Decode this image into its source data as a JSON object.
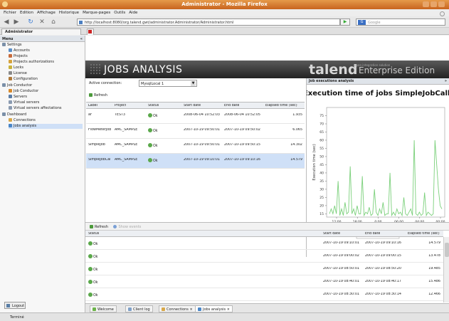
{
  "window": {
    "title": "Administrator - Mozilla Firefox"
  },
  "menubar": [
    "Fichier",
    "Edition",
    "Affichage",
    "Historique",
    "Marque-pages",
    "Outils",
    "Aide"
  ],
  "navbar": {
    "url": "http://localhost:8080/org.talend.gwt/administrator.Administrator/Administrator.html",
    "search_placeholder": "Google"
  },
  "page_tab": {
    "label": "Administrator"
  },
  "sidebar": {
    "header": "Menu",
    "items": [
      {
        "label": "Settings"
      },
      {
        "label": "Accounts"
      },
      {
        "label": "Projects"
      },
      {
        "label": "Projects authorizations"
      },
      {
        "label": "Locks"
      },
      {
        "label": "License"
      },
      {
        "label": "Configuration"
      },
      {
        "label": "Job Conductor"
      },
      {
        "label": "Job Conductor"
      },
      {
        "label": "Servers"
      },
      {
        "label": "Virtual servers"
      },
      {
        "label": "Virtual servers affectations"
      },
      {
        "label": "Dashboard"
      },
      {
        "label": "Connections"
      },
      {
        "label": "Jobs analysis"
      }
    ],
    "logout": "Logout"
  },
  "banner": {
    "title": "JOBS ANALYSIS",
    "logo": "talend",
    "logo_sub": "Enterprise Edition",
    "logo_small": "open integration solution"
  },
  "connection": {
    "label": "Active connection:",
    "value": "MysqlLocal 1"
  },
  "refresh_label": "Refresh",
  "jobs_grid": {
    "columns": [
      "Label",
      "Project",
      "Status",
      "Start date",
      "End date",
      "Elapsed time (sec)"
    ],
    "rows": [
      {
        "label": "ar",
        "project": "TEST3",
        "status": "Ok",
        "start": "2008-06-04 10:52:03",
        "end": "2008-06-04 10:52:05",
        "elapsed": "1.935"
      },
      {
        "label": "FlowMeterJob",
        "project": "AMC_SAMPLE",
        "status": "Ok",
        "start": "2007-10-19 09:50:01",
        "end": "2007-10-19 09:50:02",
        "elapsed": "6.065"
      },
      {
        "label": "SimpleJob",
        "project": "AMC_SAMPLE",
        "status": "Ok",
        "start": "2007-10-19 09:50:01",
        "end": "2007-10-19 09:50:15",
        "elapsed": "14.302"
      },
      {
        "label": "SimpleJobCal",
        "project": "AMC_SAMPLE",
        "status": "Ok",
        "start": "2007-10-19 09:10:01",
        "end": "2007-10-19 09:10:16",
        "elapsed": "14.579"
      }
    ]
  },
  "chart_panel": {
    "header": "Job executions analysis"
  },
  "chart_data": {
    "type": "line",
    "title": "Execution time of jobs SimpleJobCaller",
    "xlabel": "Date",
    "ylabel": "Execution time (sec)",
    "ylim": [
      13,
      80
    ],
    "yticks": [
      15,
      20,
      25,
      30,
      35,
      40,
      45,
      50,
      55,
      60,
      65,
      70,
      75
    ],
    "xticks": [
      "12:00",
      "18:00",
      "0:00",
      "06:00",
      "04:00",
      "00:00"
    ],
    "series": [
      {
        "name": "SimpleJobCaller",
        "values": [
          15,
          18,
          15,
          20,
          15,
          35,
          14,
          18,
          14,
          22,
          15,
          16,
          44,
          15,
          18,
          14,
          20,
          15,
          15,
          38,
          14,
          16,
          15,
          19,
          14,
          15,
          30,
          16,
          14,
          18,
          15,
          22,
          14,
          15,
          15,
          40,
          14,
          16,
          14,
          18,
          15,
          16,
          14,
          25,
          15,
          14,
          16,
          18,
          14,
          60,
          15,
          14,
          16,
          14,
          15,
          28,
          14,
          16,
          15,
          14,
          15,
          60,
          45,
          30,
          20,
          18
        ]
      }
    ],
    "legend": "bottom"
  },
  "bottom_toolbar": {
    "refresh": "Refresh",
    "show_events": "Show events"
  },
  "history_grid": {
    "columns": [
      "Status",
      "Start date",
      "End date",
      "Elapsed time (sec)"
    ],
    "rows": [
      {
        "status": "Ok",
        "start": "2007-10-19 09:10:01",
        "end": "2007-10-19 09:10:16",
        "elapsed": "14.579"
      },
      {
        "status": "Ok",
        "start": "2007-10-19 09:00:02",
        "end": "2007-10-19 09:00:15",
        "elapsed": "13.478"
      },
      {
        "status": "Ok",
        "start": "2007-10-19 08:50:01",
        "end": "2007-10-19 08:50:20",
        "elapsed": "19.485"
      },
      {
        "status": "Ok",
        "start": "2007-10-19 08:40:01",
        "end": "2007-10-19 08:40:17",
        "elapsed": "15.486"
      },
      {
        "status": "Ok",
        "start": "2007-10-19 08:30:01",
        "end": "2007-10-19 08:30:14",
        "elapsed": "12.466"
      }
    ]
  },
  "app_tabs": [
    "Welcome",
    "Client log",
    "Connections",
    "Jobs analysis"
  ],
  "statusbar": "Terminé"
}
